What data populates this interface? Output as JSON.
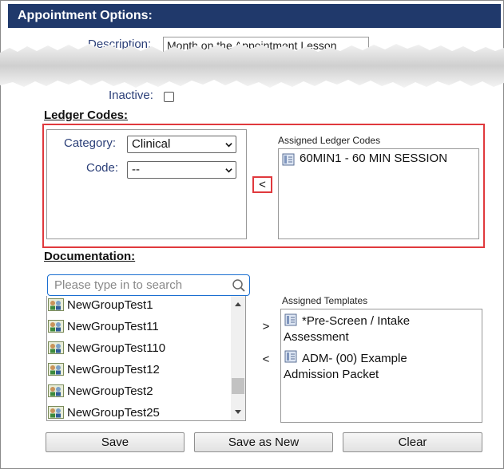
{
  "header": {
    "title": "Appointment Options:"
  },
  "description": {
    "label": "Description:",
    "value": "Month on the Appointment Lesson"
  },
  "inactive": {
    "label": "Inactive:",
    "checked": false
  },
  "ledger": {
    "heading": "Ledger Codes:",
    "category_label": "Category:",
    "category_value": "Clinical",
    "code_label": "Code:",
    "code_value": "--",
    "move_left": "<",
    "assigned_caption": "Assigned Ledger Codes",
    "assigned_items": [
      "60MIN1 - 60 MIN SESSION"
    ]
  },
  "documentation": {
    "heading": "Documentation:",
    "search_placeholder": "Please type in to search",
    "templates": [
      "NewGroupTest1",
      "NewGroupTest11",
      "NewGroupTest110",
      "NewGroupTest12",
      "NewGroupTest2",
      "NewGroupTest25"
    ],
    "move_right": ">",
    "move_left": "<",
    "assigned_caption": "Assigned Templates",
    "assigned_items": [
      {
        "line1": "*Pre-Screen / Intake",
        "line2": "Assessment"
      },
      {
        "line1": "ADM- (00) Example",
        "line2": "Admission Packet"
      }
    ]
  },
  "buttons": {
    "save": "Save",
    "save_as_new": "Save as New",
    "clear": "Clear"
  },
  "colors": {
    "header_bg": "#20396b",
    "highlight": "#e0393d",
    "label": "#2b3f78",
    "search_focus": "#1b6fd1"
  },
  "icons": [
    "search-icon",
    "chevron-down-icon",
    "group-icon",
    "document-icon",
    "scroll-up-icon",
    "scroll-down-icon"
  ]
}
